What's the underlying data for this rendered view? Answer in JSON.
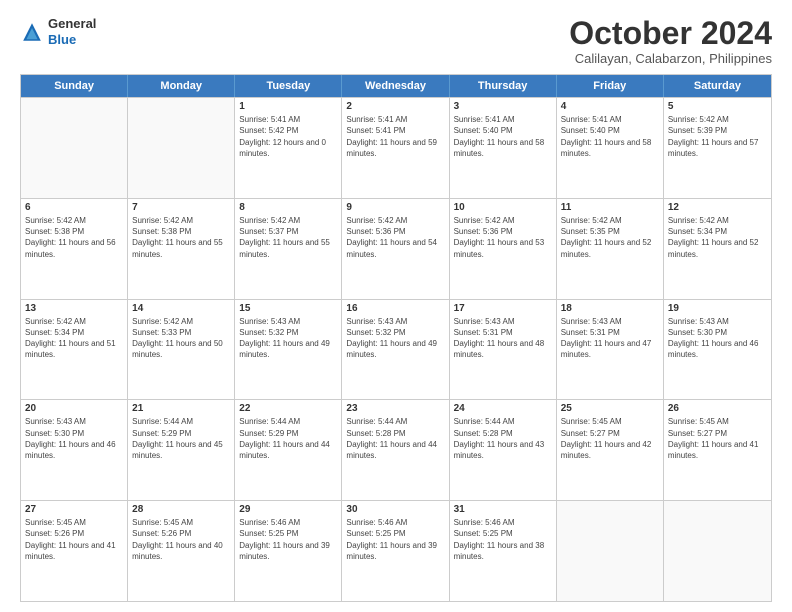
{
  "logo": {
    "line1": "General",
    "line2": "Blue"
  },
  "title": "October 2024",
  "location": "Calilayan, Calabarzon, Philippines",
  "header_days": [
    "Sunday",
    "Monday",
    "Tuesday",
    "Wednesday",
    "Thursday",
    "Friday",
    "Saturday"
  ],
  "weeks": [
    [
      {
        "day": "",
        "sunrise": "",
        "sunset": "",
        "daylight": ""
      },
      {
        "day": "",
        "sunrise": "",
        "sunset": "",
        "daylight": ""
      },
      {
        "day": "1",
        "sunrise": "Sunrise: 5:41 AM",
        "sunset": "Sunset: 5:42 PM",
        "daylight": "Daylight: 12 hours and 0 minutes."
      },
      {
        "day": "2",
        "sunrise": "Sunrise: 5:41 AM",
        "sunset": "Sunset: 5:41 PM",
        "daylight": "Daylight: 11 hours and 59 minutes."
      },
      {
        "day": "3",
        "sunrise": "Sunrise: 5:41 AM",
        "sunset": "Sunset: 5:40 PM",
        "daylight": "Daylight: 11 hours and 58 minutes."
      },
      {
        "day": "4",
        "sunrise": "Sunrise: 5:41 AM",
        "sunset": "Sunset: 5:40 PM",
        "daylight": "Daylight: 11 hours and 58 minutes."
      },
      {
        "day": "5",
        "sunrise": "Sunrise: 5:42 AM",
        "sunset": "Sunset: 5:39 PM",
        "daylight": "Daylight: 11 hours and 57 minutes."
      }
    ],
    [
      {
        "day": "6",
        "sunrise": "Sunrise: 5:42 AM",
        "sunset": "Sunset: 5:38 PM",
        "daylight": "Daylight: 11 hours and 56 minutes."
      },
      {
        "day": "7",
        "sunrise": "Sunrise: 5:42 AM",
        "sunset": "Sunset: 5:38 PM",
        "daylight": "Daylight: 11 hours and 55 minutes."
      },
      {
        "day": "8",
        "sunrise": "Sunrise: 5:42 AM",
        "sunset": "Sunset: 5:37 PM",
        "daylight": "Daylight: 11 hours and 55 minutes."
      },
      {
        "day": "9",
        "sunrise": "Sunrise: 5:42 AM",
        "sunset": "Sunset: 5:36 PM",
        "daylight": "Daylight: 11 hours and 54 minutes."
      },
      {
        "day": "10",
        "sunrise": "Sunrise: 5:42 AM",
        "sunset": "Sunset: 5:36 PM",
        "daylight": "Daylight: 11 hours and 53 minutes."
      },
      {
        "day": "11",
        "sunrise": "Sunrise: 5:42 AM",
        "sunset": "Sunset: 5:35 PM",
        "daylight": "Daylight: 11 hours and 52 minutes."
      },
      {
        "day": "12",
        "sunrise": "Sunrise: 5:42 AM",
        "sunset": "Sunset: 5:34 PM",
        "daylight": "Daylight: 11 hours and 52 minutes."
      }
    ],
    [
      {
        "day": "13",
        "sunrise": "Sunrise: 5:42 AM",
        "sunset": "Sunset: 5:34 PM",
        "daylight": "Daylight: 11 hours and 51 minutes."
      },
      {
        "day": "14",
        "sunrise": "Sunrise: 5:42 AM",
        "sunset": "Sunset: 5:33 PM",
        "daylight": "Daylight: 11 hours and 50 minutes."
      },
      {
        "day": "15",
        "sunrise": "Sunrise: 5:43 AM",
        "sunset": "Sunset: 5:32 PM",
        "daylight": "Daylight: 11 hours and 49 minutes."
      },
      {
        "day": "16",
        "sunrise": "Sunrise: 5:43 AM",
        "sunset": "Sunset: 5:32 PM",
        "daylight": "Daylight: 11 hours and 49 minutes."
      },
      {
        "day": "17",
        "sunrise": "Sunrise: 5:43 AM",
        "sunset": "Sunset: 5:31 PM",
        "daylight": "Daylight: 11 hours and 48 minutes."
      },
      {
        "day": "18",
        "sunrise": "Sunrise: 5:43 AM",
        "sunset": "Sunset: 5:31 PM",
        "daylight": "Daylight: 11 hours and 47 minutes."
      },
      {
        "day": "19",
        "sunrise": "Sunrise: 5:43 AM",
        "sunset": "Sunset: 5:30 PM",
        "daylight": "Daylight: 11 hours and 46 minutes."
      }
    ],
    [
      {
        "day": "20",
        "sunrise": "Sunrise: 5:43 AM",
        "sunset": "Sunset: 5:30 PM",
        "daylight": "Daylight: 11 hours and 46 minutes."
      },
      {
        "day": "21",
        "sunrise": "Sunrise: 5:44 AM",
        "sunset": "Sunset: 5:29 PM",
        "daylight": "Daylight: 11 hours and 45 minutes."
      },
      {
        "day": "22",
        "sunrise": "Sunrise: 5:44 AM",
        "sunset": "Sunset: 5:29 PM",
        "daylight": "Daylight: 11 hours and 44 minutes."
      },
      {
        "day": "23",
        "sunrise": "Sunrise: 5:44 AM",
        "sunset": "Sunset: 5:28 PM",
        "daylight": "Daylight: 11 hours and 44 minutes."
      },
      {
        "day": "24",
        "sunrise": "Sunrise: 5:44 AM",
        "sunset": "Sunset: 5:28 PM",
        "daylight": "Daylight: 11 hours and 43 minutes."
      },
      {
        "day": "25",
        "sunrise": "Sunrise: 5:45 AM",
        "sunset": "Sunset: 5:27 PM",
        "daylight": "Daylight: 11 hours and 42 minutes."
      },
      {
        "day": "26",
        "sunrise": "Sunrise: 5:45 AM",
        "sunset": "Sunset: 5:27 PM",
        "daylight": "Daylight: 11 hours and 41 minutes."
      }
    ],
    [
      {
        "day": "27",
        "sunrise": "Sunrise: 5:45 AM",
        "sunset": "Sunset: 5:26 PM",
        "daylight": "Daylight: 11 hours and 41 minutes."
      },
      {
        "day": "28",
        "sunrise": "Sunrise: 5:45 AM",
        "sunset": "Sunset: 5:26 PM",
        "daylight": "Daylight: 11 hours and 40 minutes."
      },
      {
        "day": "29",
        "sunrise": "Sunrise: 5:46 AM",
        "sunset": "Sunset: 5:25 PM",
        "daylight": "Daylight: 11 hours and 39 minutes."
      },
      {
        "day": "30",
        "sunrise": "Sunrise: 5:46 AM",
        "sunset": "Sunset: 5:25 PM",
        "daylight": "Daylight: 11 hours and 39 minutes."
      },
      {
        "day": "31",
        "sunrise": "Sunrise: 5:46 AM",
        "sunset": "Sunset: 5:25 PM",
        "daylight": "Daylight: 11 hours and 38 minutes."
      },
      {
        "day": "",
        "sunrise": "",
        "sunset": "",
        "daylight": ""
      },
      {
        "day": "",
        "sunrise": "",
        "sunset": "",
        "daylight": ""
      }
    ]
  ]
}
